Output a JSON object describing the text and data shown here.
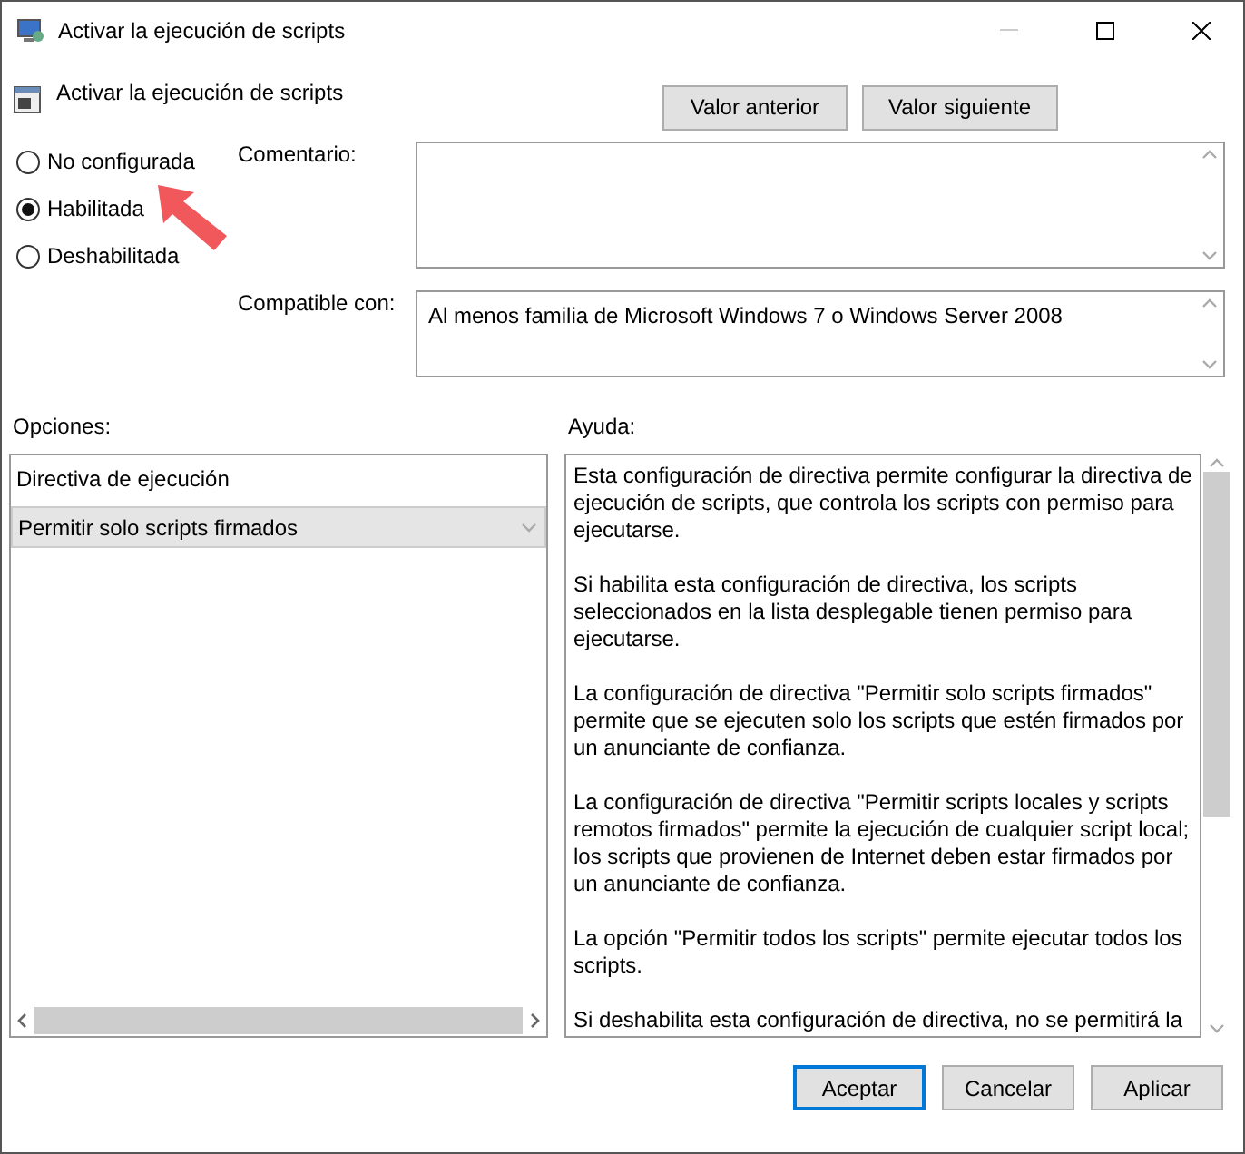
{
  "window": {
    "title": "Activar la ejecución de scripts"
  },
  "header": {
    "title": "Activar la ejecución de scripts",
    "buttons": [
      "Valor anterior",
      "Valor siguiente"
    ]
  },
  "state_options": [
    {
      "label": "No configurada",
      "selected": false
    },
    {
      "label": "Habilitada",
      "selected": true
    },
    {
      "label": "Deshabilitada",
      "selected": false
    }
  ],
  "comment": {
    "label": "Comentario:"
  },
  "supported_on": {
    "label": "Compatible con:",
    "value": "Al menos familia de Microsoft Windows 7 o Windows Server 2008"
  },
  "options": {
    "label": "Opciones:",
    "setting_label": "Directiva de ejecución",
    "dropdown_value": "Permitir solo scripts firmados"
  },
  "help": {
    "label": "Ayuda:",
    "paragraphs": [
      "Esta configuración de directiva permite configurar la directiva de ejecución de scripts, que controla los scripts con permiso para ejecutarse.",
      "Si habilita esta configuración de directiva, los scripts seleccionados en la lista desplegable tienen permiso para ejecutarse.",
      "La configuración de directiva \"Permitir solo scripts firmados\" permite que se ejecuten solo los scripts que estén firmados por un anunciante de confianza.",
      "La configuración de directiva \"Permitir scripts locales y scripts remotos firmados\" permite la ejecución de cualquier script local; los scripts que provienen de Internet deben estar firmados por un anunciante de confianza.",
      "La opción \"Permitir todos los scripts\" permite ejecutar todos los scripts.",
      "Si deshabilita esta configuración de directiva, no se permitirá la"
    ]
  },
  "footer_buttons": [
    {
      "label": "Aceptar",
      "default": true
    },
    {
      "label": "Cancelar",
      "default": false
    },
    {
      "label": "Aplicar",
      "default": false
    }
  ]
}
